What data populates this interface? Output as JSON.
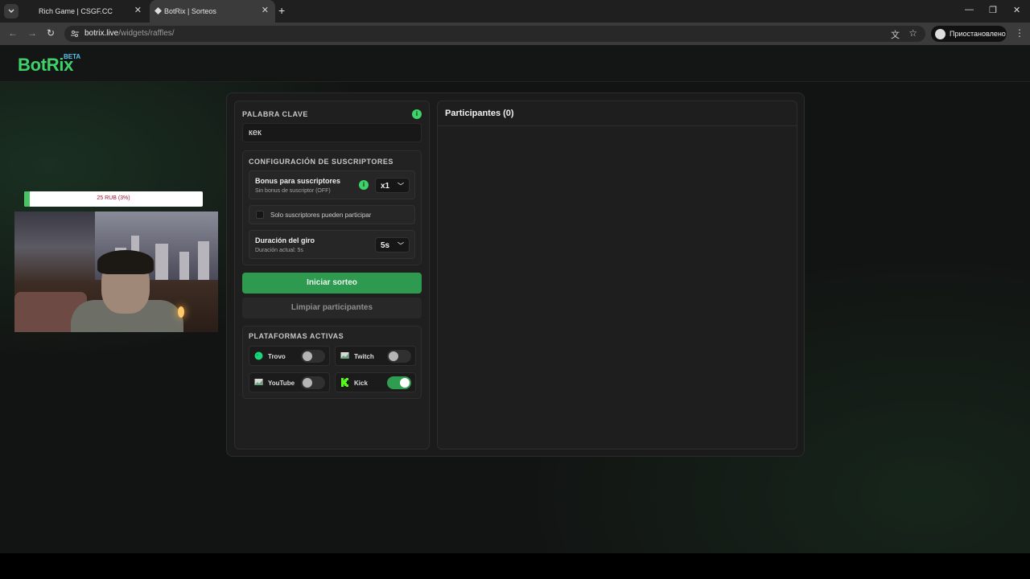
{
  "browser": {
    "tabs": [
      {
        "title": "Rich Game | CSGF.CC"
      },
      {
        "title": "BotRix | Sorteos"
      }
    ],
    "url_host": "botrix.live",
    "url_path": "/widgets/raffles/",
    "profile_label": "Приостановлено"
  },
  "site": {
    "logo": "BotRix",
    "badge": "BETA"
  },
  "overlay": {
    "donation_label": "25 RUB (3%)",
    "donation_progress": 0.03
  },
  "raffle": {
    "keyword_label": "PALABRA CLAVE",
    "keyword_value": "кек",
    "subscribers": {
      "section_label": "CONFIGURACIÓN DE SUSCRIPTORES",
      "bonus_title": "Bonus para suscriptores",
      "bonus_subtitle": "Sin bonus de suscriptor (OFF)",
      "bonus_value": "x1",
      "only_subs_label": "Solo suscriptores pueden participar",
      "spin_title": "Duración del giro",
      "spin_subtitle": "Duración actual: 5s",
      "spin_value": "5s"
    },
    "start_button": "Iniciar sorteo",
    "clear_button": "Limpiar participantes",
    "platforms": {
      "section_label": "PLATAFORMAS ACTIVAS",
      "items": [
        {
          "name": "Trovo",
          "enabled": false
        },
        {
          "name": "Twitch",
          "enabled": false
        },
        {
          "name": "YouTube",
          "enabled": false
        },
        {
          "name": "Kick",
          "enabled": true
        }
      ]
    },
    "participants_title": "Participantes (0)"
  },
  "colors": {
    "accent": "#3fd16a",
    "button_green": "#2d9a4f",
    "badge_blue": "#58c3f0"
  }
}
